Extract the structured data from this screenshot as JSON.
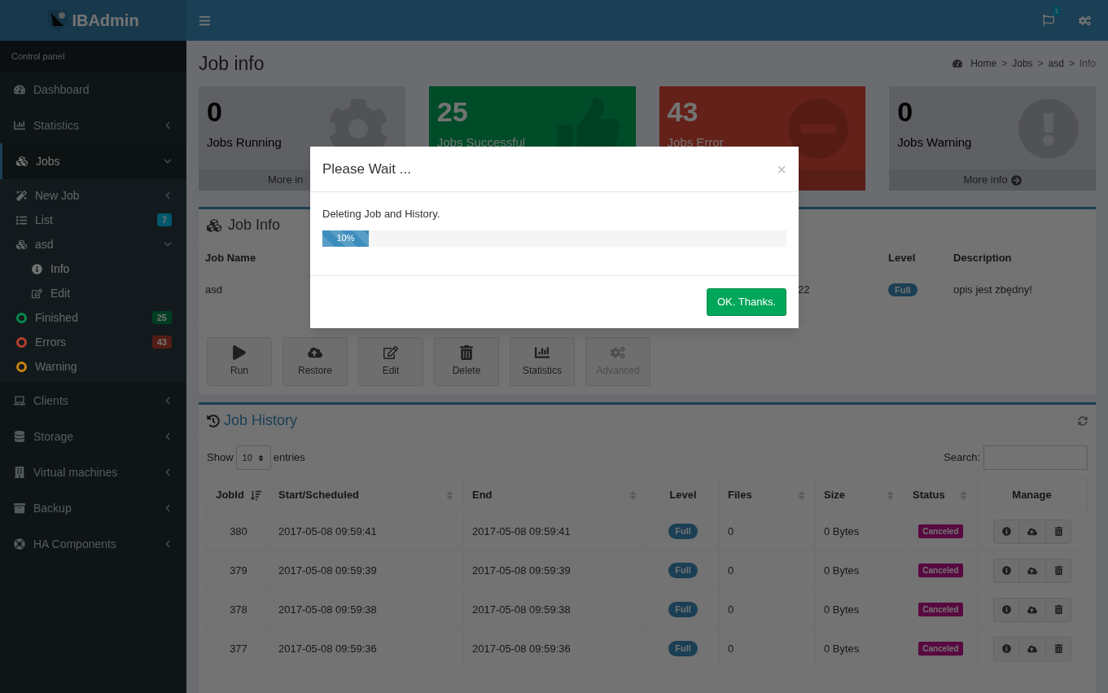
{
  "header": {
    "logo": "IBAdmin",
    "notification_count": "1"
  },
  "sidebar": {
    "section_label": "Control panel",
    "items": [
      {
        "label": "Dashboard",
        "selected": false
      },
      {
        "label": "Statistics",
        "selected": false,
        "expanded": false
      },
      {
        "label": "Jobs",
        "selected": true,
        "expanded": true,
        "children": [
          {
            "label": "New Job",
            "selected": false,
            "expanded": false
          },
          {
            "label": "List",
            "selected": false,
            "badge": "7"
          },
          {
            "label": "asd",
            "selected": false,
            "expanded": true,
            "children": [
              {
                "label": "Info",
                "selected": true
              },
              {
                "label": "Edit",
                "selected": false
              }
            ]
          },
          {
            "label": "Finished",
            "selected": false,
            "color": "#008a4b",
            "badge": "25"
          },
          {
            "label": "Errors",
            "selected": false,
            "color": "#b83e2f",
            "badge": "43"
          },
          {
            "label": "Warning",
            "selected": false,
            "color": "#c98210"
          }
        ]
      },
      {
        "label": "Clients",
        "selected": false,
        "expanded": false
      },
      {
        "label": "Storage",
        "selected": false,
        "expanded": false
      },
      {
        "label": "Virtual machines",
        "selected": false,
        "expanded": false
      },
      {
        "label": "Backup",
        "selected": false,
        "expanded": false
      },
      {
        "label": "HA Components",
        "selected": false,
        "expanded": false
      }
    ]
  },
  "page": {
    "title": "Job info",
    "breadcrumb": [
      "Home",
      "Jobs",
      "asd",
      "Info"
    ],
    "separator": ">"
  },
  "stat_boxes": [
    {
      "kind": "neutral",
      "value": "0",
      "label": "Jobs Running",
      "footer": "More in"
    },
    {
      "kind": "success",
      "value": "25",
      "label": "Jobs Successful"
    },
    {
      "kind": "danger",
      "value": "43",
      "label": "Jobs Error"
    },
    {
      "kind": "neutral",
      "value": "0",
      "label": "Jobs Warning",
      "footer": "More info"
    }
  ],
  "job_info": {
    "title": "Job Info",
    "columns": [
      "Job Name",
      "Level",
      "Description"
    ],
    "row": {
      "job_name": "asd",
      "column_3": "22",
      "level": "Full",
      "description": "opis jest zbędny!"
    }
  },
  "actions": [
    {
      "label": "Run",
      "disabled": false
    },
    {
      "label": "Restore",
      "disabled": false
    },
    {
      "label": "Edit",
      "disabled": false
    },
    {
      "label": "Delete",
      "disabled": false
    },
    {
      "label": "Statistics",
      "disabled": false
    },
    {
      "label": "Advanced",
      "disabled": true
    }
  ],
  "job_history": {
    "title": "Job History",
    "show_label": "Show",
    "page_size": "10",
    "entries_label": "entries",
    "search_label": "Search:",
    "columns": [
      {
        "label": "JobId",
        "sortable": true,
        "sorted": true
      },
      {
        "label": "Start/Scheduled",
        "sortable": true,
        "sorted": false
      },
      {
        "label": "End",
        "sortable": true,
        "sorted": false
      },
      {
        "label": "Level",
        "sortable": false
      },
      {
        "label": "Files",
        "sortable": true,
        "sorted": false
      },
      {
        "label": "Size",
        "sortable": true,
        "sorted": false
      },
      {
        "label": "Status",
        "sortable": true,
        "sorted": false
      },
      {
        "label": "Manage",
        "sortable": false
      }
    ],
    "rows": [
      {
        "job_id": "380",
        "start": "2017-05-08 09:59:41",
        "end": "2017-05-08 09:59:41",
        "level": "Full",
        "files": "0",
        "size": "0 Bytes",
        "status": "Canceled"
      },
      {
        "job_id": "379",
        "start": "2017-05-08 09:59:39",
        "end": "2017-05-08 09:59:39",
        "level": "Full",
        "files": "0",
        "size": "0 Bytes",
        "status": "Canceled"
      },
      {
        "job_id": "378",
        "start": "2017-05-08 09:59:38",
        "end": "2017-05-08 09:59:38",
        "level": "Full",
        "files": "0",
        "size": "0 Bytes",
        "status": "Canceled"
      },
      {
        "job_id": "377",
        "start": "2017-05-08 09:59:36",
        "end": "2017-05-08 09:59:36",
        "level": "Full",
        "files": "0",
        "size": "0 Bytes",
        "status": "Canceled"
      }
    ]
  },
  "modal": {
    "title": "Please Wait ...",
    "close": "×",
    "message": "Deleting Job and History.",
    "progress": {
      "level": 0.1,
      "label": "10%"
    },
    "button": "OK. Thanks."
  }
}
